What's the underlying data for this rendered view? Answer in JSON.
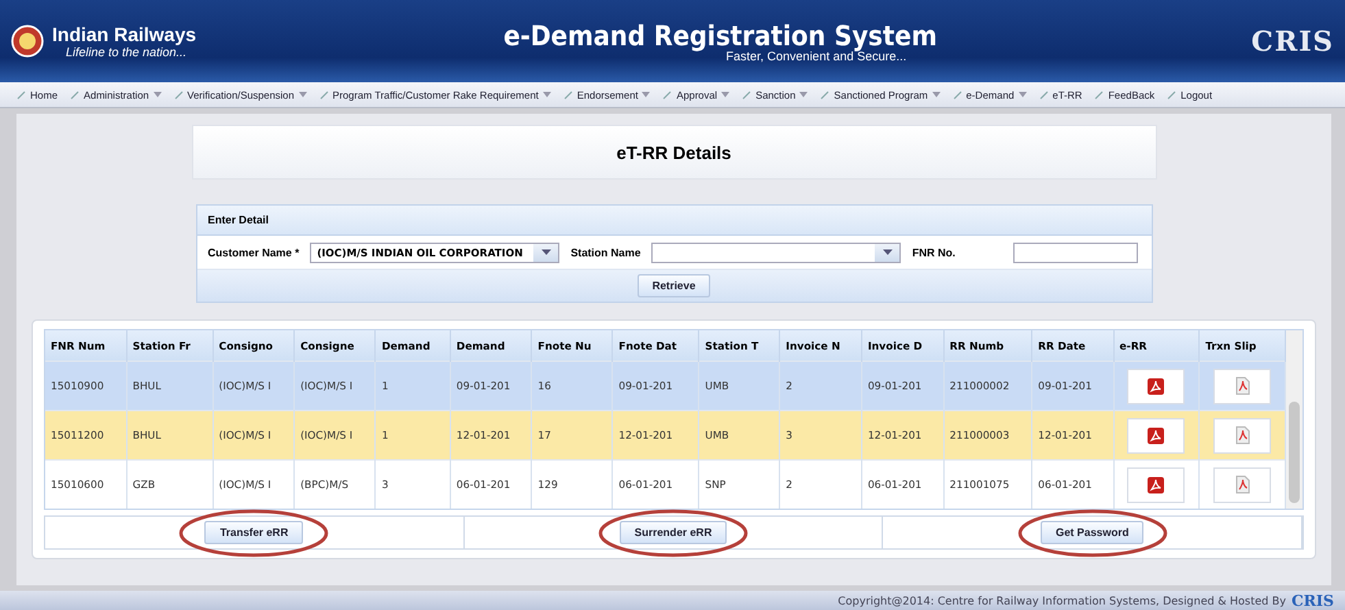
{
  "header": {
    "brand": "Indian Railways",
    "tagline": "Lifeline to the nation...",
    "title": "e-Demand Registration System",
    "subtitle": "Faster, Convenient and Secure...",
    "logo_right": "CRIS"
  },
  "nav": [
    {
      "label": "Home",
      "dropdown": false
    },
    {
      "label": "Administration",
      "dropdown": true
    },
    {
      "label": "Verification/Suspension",
      "dropdown": true
    },
    {
      "label": "Program Traffic/Customer Rake Requirement",
      "dropdown": true
    },
    {
      "label": "Endorsement",
      "dropdown": true
    },
    {
      "label": "Approval",
      "dropdown": true
    },
    {
      "label": "Sanction",
      "dropdown": true
    },
    {
      "label": "Sanctioned Program",
      "dropdown": true
    },
    {
      "label": "e-Demand",
      "dropdown": true
    },
    {
      "label": "eT-RR",
      "dropdown": false
    },
    {
      "label": "FeedBack",
      "dropdown": false
    },
    {
      "label": "Logout",
      "dropdown": false
    }
  ],
  "page_title": "eT-RR Details",
  "form": {
    "legend": "Enter Detail",
    "customer_label": "Customer Name *",
    "customer_value": "(IOC)M/S INDIAN OIL CORPORATION",
    "station_label": "Station Name",
    "fnr_label": "FNR No.",
    "retrieve": "Retrieve"
  },
  "table": {
    "columns": [
      "FNR Num",
      "Station Fr",
      "Consigno",
      "Consigne",
      "Demand",
      "Demand",
      "Fnote Nu",
      "Fnote Dat",
      "Station T",
      "Invoice N",
      "Invoice D",
      "RR Numb",
      "RR Date",
      "e-RR",
      "Trxn Slip"
    ],
    "rows": [
      {
        "selected": true,
        "highlighted": false,
        "cells": [
          "15010900",
          "BHUL",
          "(IOC)M/S I",
          "(IOC)M/S I",
          "1",
          "09-01-201",
          "16",
          "09-01-201",
          "UMB",
          "2",
          "09-01-201",
          "211000002",
          "09-01-201"
        ]
      },
      {
        "selected": false,
        "highlighted": true,
        "cells": [
          "15011200",
          "BHUL",
          "(IOC)M/S I",
          "(IOC)M/S I",
          "1",
          "12-01-201",
          "17",
          "12-01-201",
          "UMB",
          "3",
          "12-01-201",
          "211000003",
          "12-01-201"
        ]
      },
      {
        "selected": false,
        "highlighted": false,
        "cells": [
          "15010600",
          "GZB",
          "(IOC)M/S I",
          "(BPC)M/S",
          "3",
          "06-01-201",
          "129",
          "06-01-201",
          "SNP",
          "2",
          "06-01-201",
          "211001075",
          "06-01-201"
        ]
      }
    ]
  },
  "buttons": [
    {
      "label": "Transfer eRR",
      "circled": true
    },
    {
      "label": "Surrender eRR",
      "circled": true
    },
    {
      "label": "Get Password",
      "circled": true
    }
  ],
  "footer": {
    "text": "Copyright@2014: Centre for Railway Information Systems, Designed & Hosted By",
    "logo": "CRIS"
  }
}
